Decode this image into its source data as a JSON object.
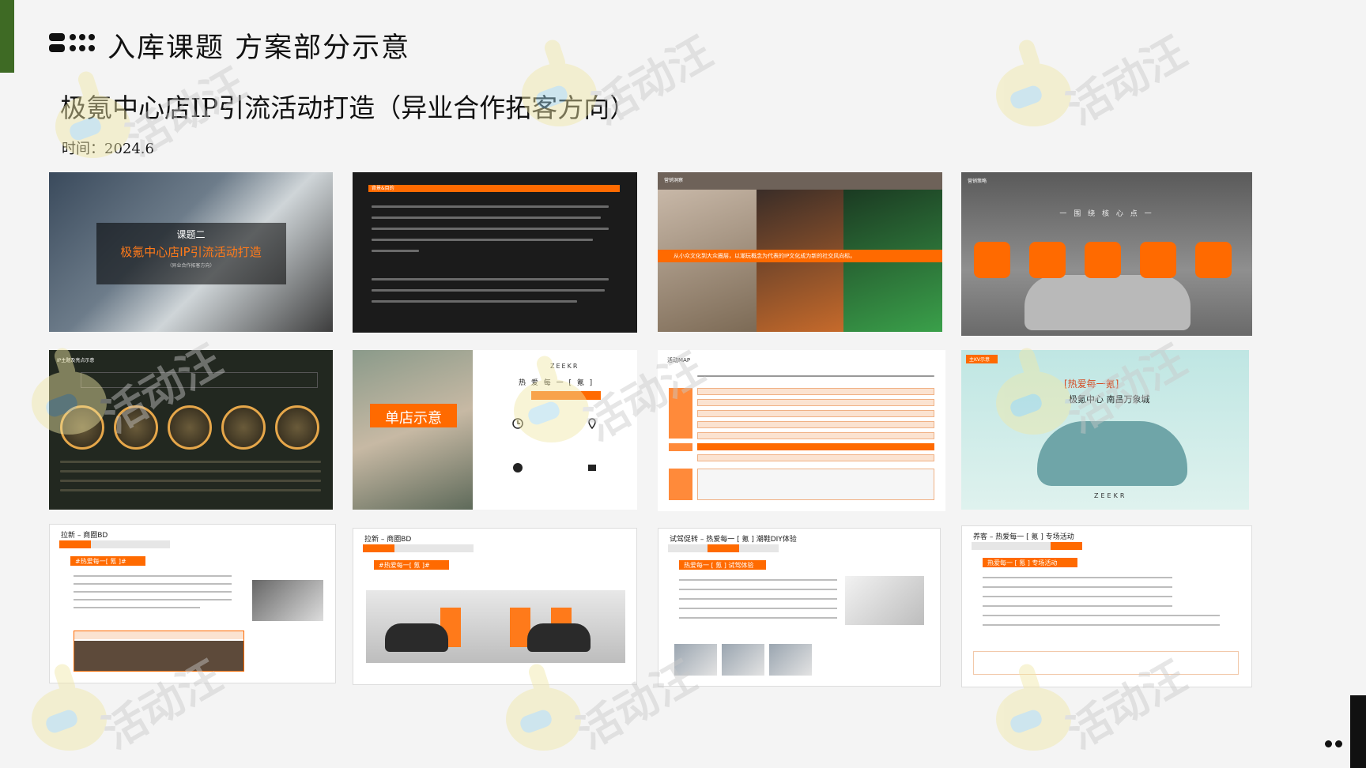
{
  "header": {
    "title": "入库课题  方案部分示意",
    "subtitle": "极氪中心店IP引流活动打造（异业合作拓客方向）",
    "date": "时间：2024.6"
  },
  "watermark": {
    "text": "活动汪"
  },
  "colors": {
    "accent": "#ff6a00",
    "green_bar": "#3e6a24"
  },
  "slides": {
    "s1": {
      "kicker": "课题二",
      "title": "极氪中心店IP引流活动打造",
      "note": "（异业合作拓客方向）"
    },
    "s2": {
      "header": "背景&目的"
    },
    "s3": {
      "header": "营销洞察",
      "banner": "从小众文化到大众圈层，以潮玩概念为代表的IP文化成为新的社交风向标。"
    },
    "s4": {
      "header": "营销策略",
      "center": "一 围 绕  核 心 点 一"
    },
    "s5": {
      "header": "IP主题及亮点示意"
    },
    "s6": {
      "tag": "单店示意",
      "brand": "ZEEKR",
      "slogan": "热 爱 每 一 [ 氪 ]"
    },
    "s7": {
      "title": "活动MAP"
    },
    "s8": {
      "kv": "主KV示意",
      "love": "[热爱每一氪]",
      "center": "极氪中心  南昌万象城",
      "brand": "ZEEKR"
    },
    "s9": {
      "title": "拉新 – 商圈BD",
      "pill": "#热爱每一[ 氪 ]#"
    },
    "s10": {
      "title": "拉新 – 商圈BD",
      "pill": "#热爱每一[ 氪 ]#"
    },
    "s11": {
      "title": "试驾促转 – 热爱每一 [ 氪 ] 潮鞋DIY体验",
      "pill": "热爱每一 [ 氪 ] 试驾体验"
    },
    "s12": {
      "title": "养客 – 热爱每一 [ 氪 ] 专场活动",
      "pill": "热爱每一 [ 氪 ] 专场活动"
    }
  }
}
